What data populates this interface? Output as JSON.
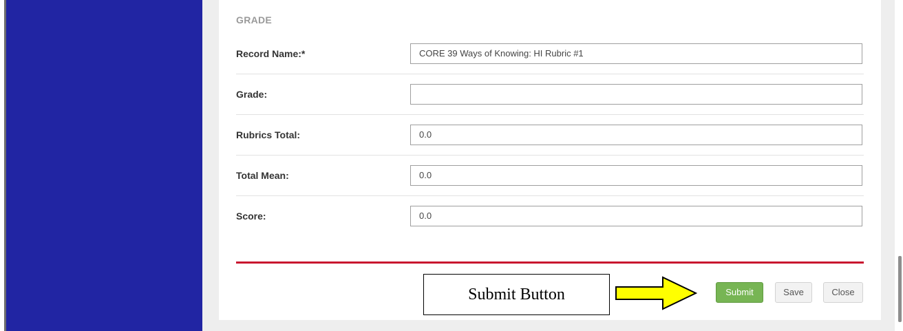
{
  "colors": {
    "sidebar": "#2125a3",
    "accent_divider": "#c8102e",
    "submit_button": "#77b554",
    "callout_arrow_fill": "#ffff00"
  },
  "form": {
    "section_title": "GRADE",
    "fields": [
      {
        "label": "Record Name:*",
        "value": "CORE 39 Ways of Knowing: HI Rubric #1"
      },
      {
        "label": "Grade:",
        "value": ""
      },
      {
        "label": "Rubrics Total:",
        "value": "0.0"
      },
      {
        "label": "Total Mean:",
        "value": "0.0"
      },
      {
        "label": "Score:",
        "value": "0.0"
      }
    ]
  },
  "actions": {
    "submit_label": "Submit",
    "save_label": "Save",
    "close_label": "Close"
  },
  "annotation": {
    "callout_text": "Submit Button",
    "arrow_icon": "right-arrow-icon"
  }
}
